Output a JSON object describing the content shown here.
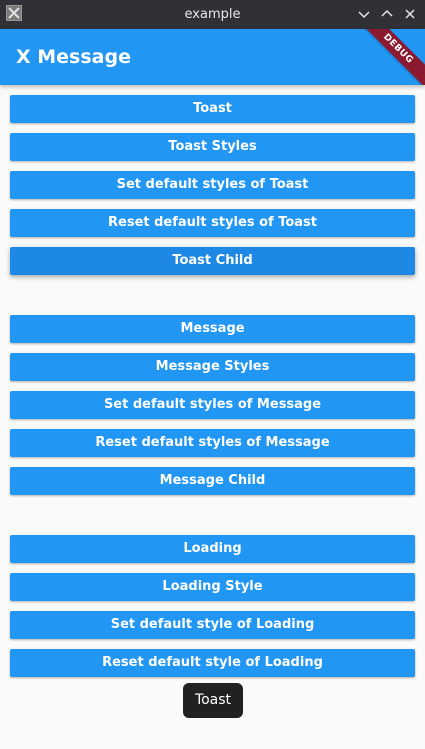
{
  "window": {
    "title": "example",
    "controls": {
      "minimize_icon": "chevron-down-icon",
      "maximize_icon": "chevron-up-icon",
      "close_icon": "close-icon"
    }
  },
  "appbar": {
    "title": "X Message",
    "debug_banner": "DEBUG",
    "color": "#2196f3"
  },
  "buttons": {
    "toast": "Toast",
    "toast_styles": "Toast Styles",
    "set_default_toast": "Set default styles of Toast",
    "reset_default_toast": "Reset default styles of Toast",
    "toast_child": "Toast Child",
    "message": "Message",
    "message_styles": "Message Styles",
    "set_default_message": "Set default styles of Message",
    "reset_default_message": "Reset default styles of Message",
    "message_child": "Message Child",
    "loading": "Loading",
    "loading_style": "Loading Style",
    "set_default_loading": "Set default style of Loading",
    "reset_default_loading": "Reset default style of Loading"
  },
  "toast": {
    "text": "Toast"
  }
}
